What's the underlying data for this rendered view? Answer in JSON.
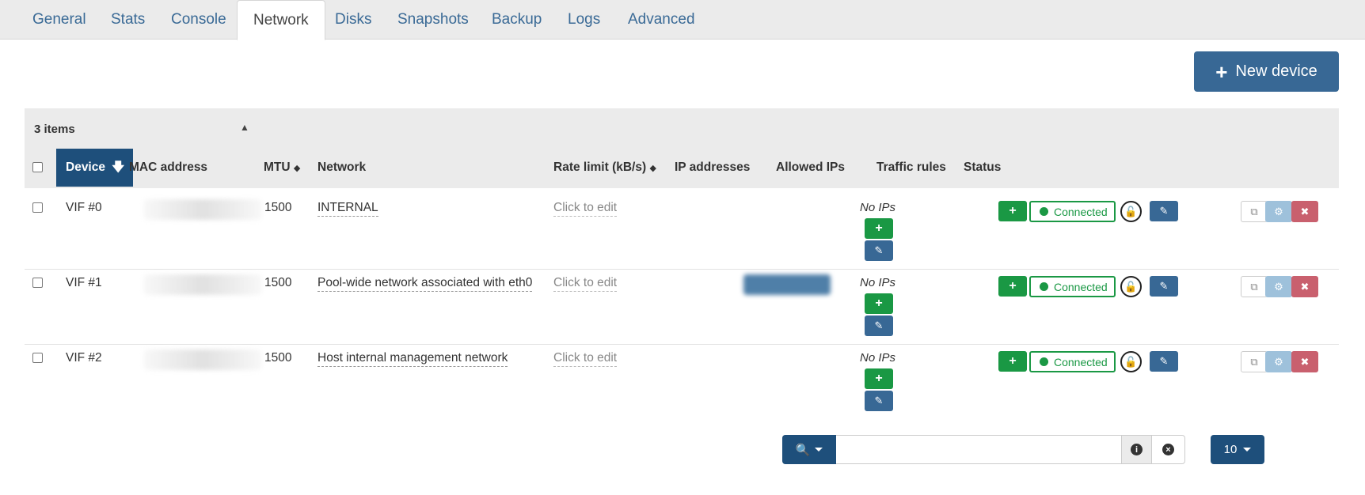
{
  "tabs": [
    {
      "label": "General",
      "active": false
    },
    {
      "label": "Stats",
      "active": false
    },
    {
      "label": "Console",
      "active": false
    },
    {
      "label": "Network",
      "active": true
    },
    {
      "label": "Disks",
      "active": false
    },
    {
      "label": "Snapshots",
      "active": false
    },
    {
      "label": "Backup",
      "active": false
    },
    {
      "label": "Logs",
      "active": false
    },
    {
      "label": "Advanced",
      "active": false
    }
  ],
  "toolbar": {
    "new_device_label": "New device"
  },
  "table": {
    "items_count": "3 items",
    "columns": {
      "device": "Device",
      "mac": "MAC address",
      "mtu": "MTU",
      "network": "Network",
      "rate_limit": "Rate limit (kB/s)",
      "ip_addresses": "IP addresses",
      "allowed_ips": "Allowed IPs",
      "traffic_rules": "Traffic rules",
      "status": "Status"
    },
    "rows": [
      {
        "device": "VIF #0",
        "mtu": "1500",
        "network": "INTERNAL",
        "rate_limit": "Click to edit",
        "allowed_ips": "No IPs",
        "status": "Connected"
      },
      {
        "device": "VIF #1",
        "mtu": "1500",
        "network": "Pool-wide network associated with eth0",
        "rate_limit": "Click to edit",
        "allowed_ips": "No IPs",
        "status": "Connected"
      },
      {
        "device": "VIF #2",
        "mtu": "1500",
        "network": "Host internal management network",
        "rate_limit": "Click to edit",
        "allowed_ips": "No IPs",
        "status": "Connected"
      }
    ]
  },
  "pagination": {
    "page_size": "10"
  },
  "colors": {
    "primary": "#386895",
    "dark_primary": "#1e4f7b",
    "success": "#1a9844",
    "danger": "#c9606e"
  }
}
